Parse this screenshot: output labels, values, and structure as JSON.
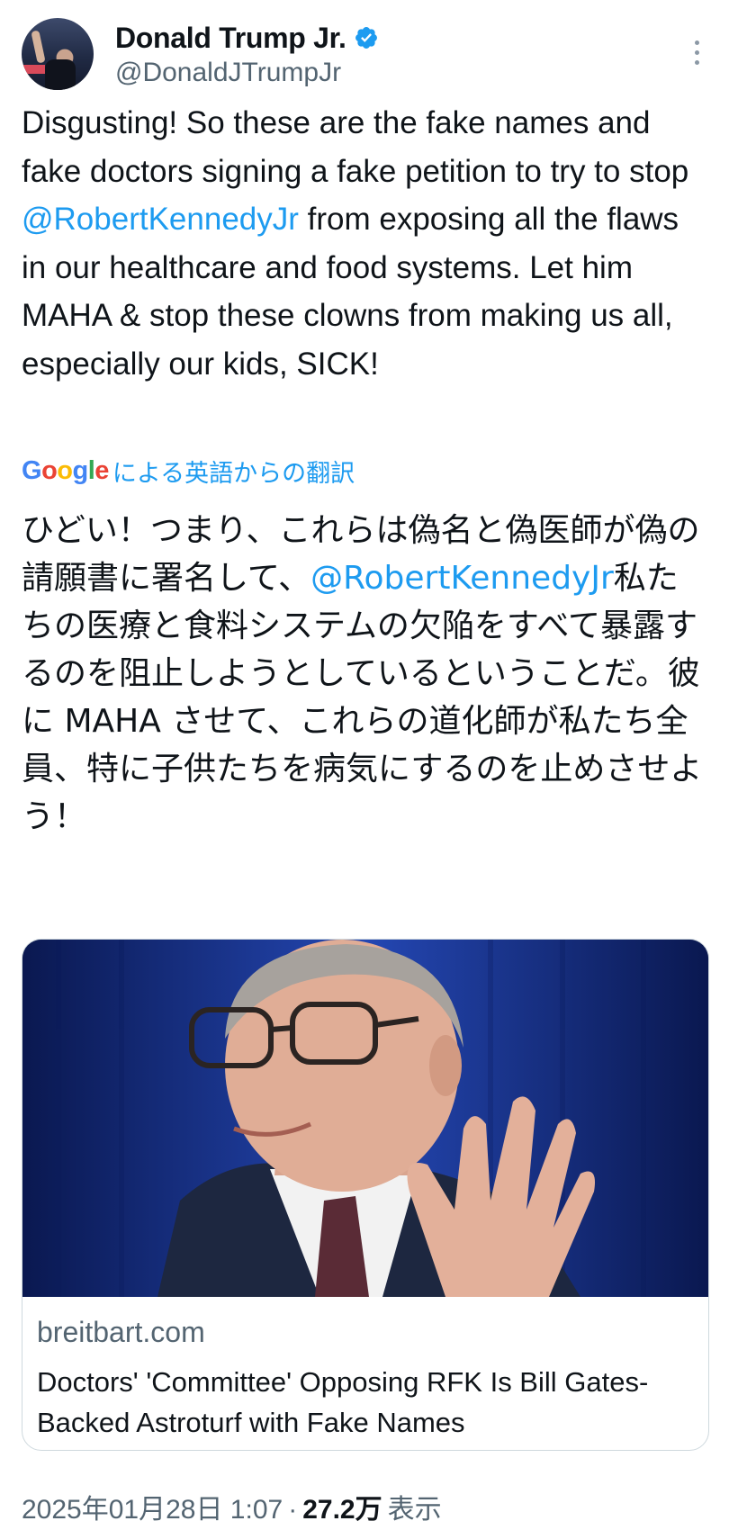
{
  "author": {
    "name": "Donald Trump Jr.",
    "handle": "@DonaldJTrumpJr",
    "avatar_icon": "profile-photo",
    "verified_icon": "verified-badge-icon",
    "verified_color": "#1d9bf0"
  },
  "menu_icon": "more-options-icon",
  "tweet": {
    "text_before": "Disgusting! So these are the fake names and fake doctors signing a fake petition to try to stop ",
    "mention": "@RobertKennedyJr",
    "text_after": " from exposing all the flaws in our healthcare and food systems. Let him MAHA & stop these clowns from making us all, especially our kids, SICK!"
  },
  "translation": {
    "provider": "Google",
    "label": "による英語からの翻訳",
    "text_before": "ひどい！つまり、これらは偽名と偽医師が偽の請願書に署名して、",
    "mention": "@RobertKennedyJr",
    "text_after": "私たちの医療と食料システムの欠陥をすべて暴露するのを阻止しようとしているということだ。彼に MAHA させて、これらの道化師が私たち全員、特に子供たちを病気にするのを止めさせよう！"
  },
  "link_card": {
    "image_alt": "photo-of-man-in-suit-waving",
    "domain": "breitbart.com",
    "title": "Doctors' 'Committee' Opposing RFK Is Bill Gates-Backed Astroturf with Fake Names"
  },
  "footer": {
    "timestamp": "2025年01月28日 1:07",
    "separator": "·",
    "views_count": "27.2万",
    "views_label": "表示"
  },
  "colors": {
    "link": "#1d9bf0",
    "secondary_text": "#536471",
    "primary_text": "#0f1419",
    "card_border": "#cfd9de"
  }
}
